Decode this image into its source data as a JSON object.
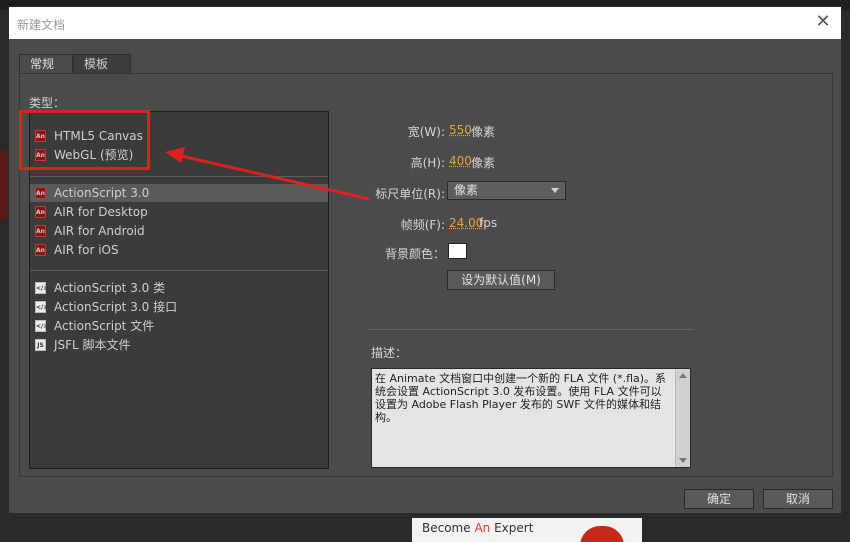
{
  "dialog": {
    "title": "新建文档",
    "close_label": "✕"
  },
  "tabs": [
    {
      "label": "常规",
      "active": true
    },
    {
      "label": "模板",
      "active": false
    }
  ],
  "type_label": "类型：",
  "type_groups": [
    [
      {
        "label": "HTML5 Canvas",
        "icon": "an-icon"
      },
      {
        "label": "WebGL (预览)",
        "icon": "an-icon"
      }
    ],
    [
      {
        "label": "ActionScript 3.0",
        "icon": "an-icon",
        "selected": true
      },
      {
        "label": "AIR for Desktop",
        "icon": "an-icon"
      },
      {
        "label": "AIR for Android",
        "icon": "an-icon"
      },
      {
        "label": "AIR for iOS",
        "icon": "an-icon"
      }
    ],
    [
      {
        "label": "ActionScript 3.0 类",
        "icon": "code-file-icon"
      },
      {
        "label": "ActionScript 3.0 接口",
        "icon": "code-file-icon"
      },
      {
        "label": "ActionScript 文件",
        "icon": "code-file-icon"
      },
      {
        "label": "JSFL 脚本文件",
        "icon": "jsfl-file-icon"
      }
    ]
  ],
  "properties": {
    "width": {
      "label": "宽(W):",
      "value": "550",
      "unit": "像素"
    },
    "height": {
      "label": "高(H):",
      "value": "400",
      "unit": "像素"
    },
    "ruler_units": {
      "label": "标尺单位(R):",
      "value": "像素"
    },
    "frame_rate": {
      "label": "帧频(F):",
      "value": "24.00",
      "unit": "fps"
    },
    "background_color": {
      "label": "背景颜色：",
      "value": "#ffffff"
    }
  },
  "set_default_button": "设为默认值(M)",
  "description": {
    "label": "描述：",
    "text": "在 Animate 文档窗口中创建一个新的 FLA 文件 (*.fla)。系统会设置 ActionScript 3.0 发布设置。使用 FLA 文件可以设置为 Adobe Flash Player 发布的 SWF 文件的媒体和结构。"
  },
  "buttons": {
    "ok": "确定",
    "cancel": "取消"
  },
  "background": {
    "promo_text_prefix": "Become ",
    "promo_text_accent": "An",
    "promo_text_suffix": " Expert"
  },
  "colors": {
    "dialog_bg": "#4b4b4b",
    "highlight": "#e01f1f",
    "value_accent": "#e8a33c",
    "adobe_red": "#7a1b1b"
  }
}
